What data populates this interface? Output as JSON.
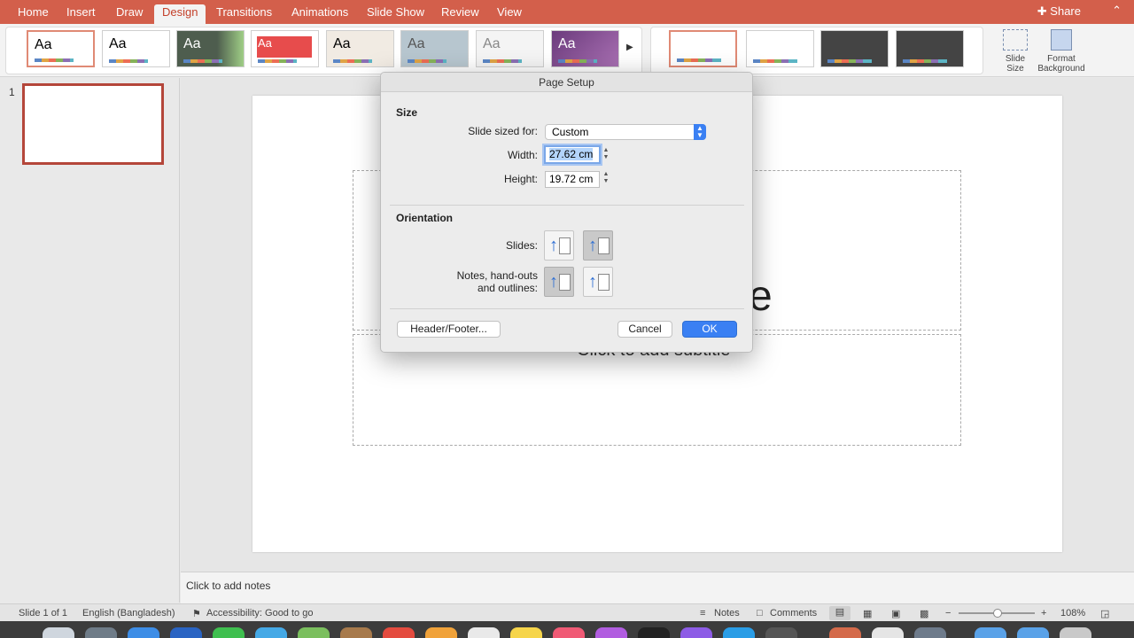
{
  "ribbon_tabs": [
    {
      "label": "Home"
    },
    {
      "label": "Insert"
    },
    {
      "label": "Draw"
    },
    {
      "label": "Design"
    },
    {
      "label": "Transitions"
    },
    {
      "label": "Animations"
    },
    {
      "label": "Slide Show"
    },
    {
      "label": "Review"
    },
    {
      "label": "View"
    }
  ],
  "active_tab": "Design",
  "share_label": "Share",
  "theme_sample": "Aa",
  "ribbon_buttons": {
    "slide_size": "Slide Size",
    "format_background": "Format Background"
  },
  "slide_panel": {
    "slide_number": "1"
  },
  "slide": {
    "title_visible": "tle",
    "subtitle_visible": "Click to add subtitle"
  },
  "notes_placeholder": "Click to add notes",
  "status": {
    "slide_of": "Slide 1 of 1",
    "language": "English (Bangladesh)",
    "accessibility": "Accessibility: Good to go",
    "notes": "Notes",
    "comments": "Comments",
    "zoom": "108%"
  },
  "dialog": {
    "title": "Page Setup",
    "size_heading": "Size",
    "slide_sized_for_label": "Slide sized for:",
    "slide_sized_for_value": "Custom",
    "width_label": "Width:",
    "width_value": "27.62 cm",
    "height_label": "Height:",
    "height_value": "19.72 cm",
    "orientation_heading": "Orientation",
    "slides_label": "Slides:",
    "notes_label_line1": "Notes, hand-outs",
    "notes_label_line2": "and outlines:",
    "header_footer_button": "Header/Footer...",
    "cancel_button": "Cancel",
    "ok_button": "OK"
  },
  "colors": {
    "accent": "#d35f4b",
    "primary_button": "#3a80f3"
  }
}
